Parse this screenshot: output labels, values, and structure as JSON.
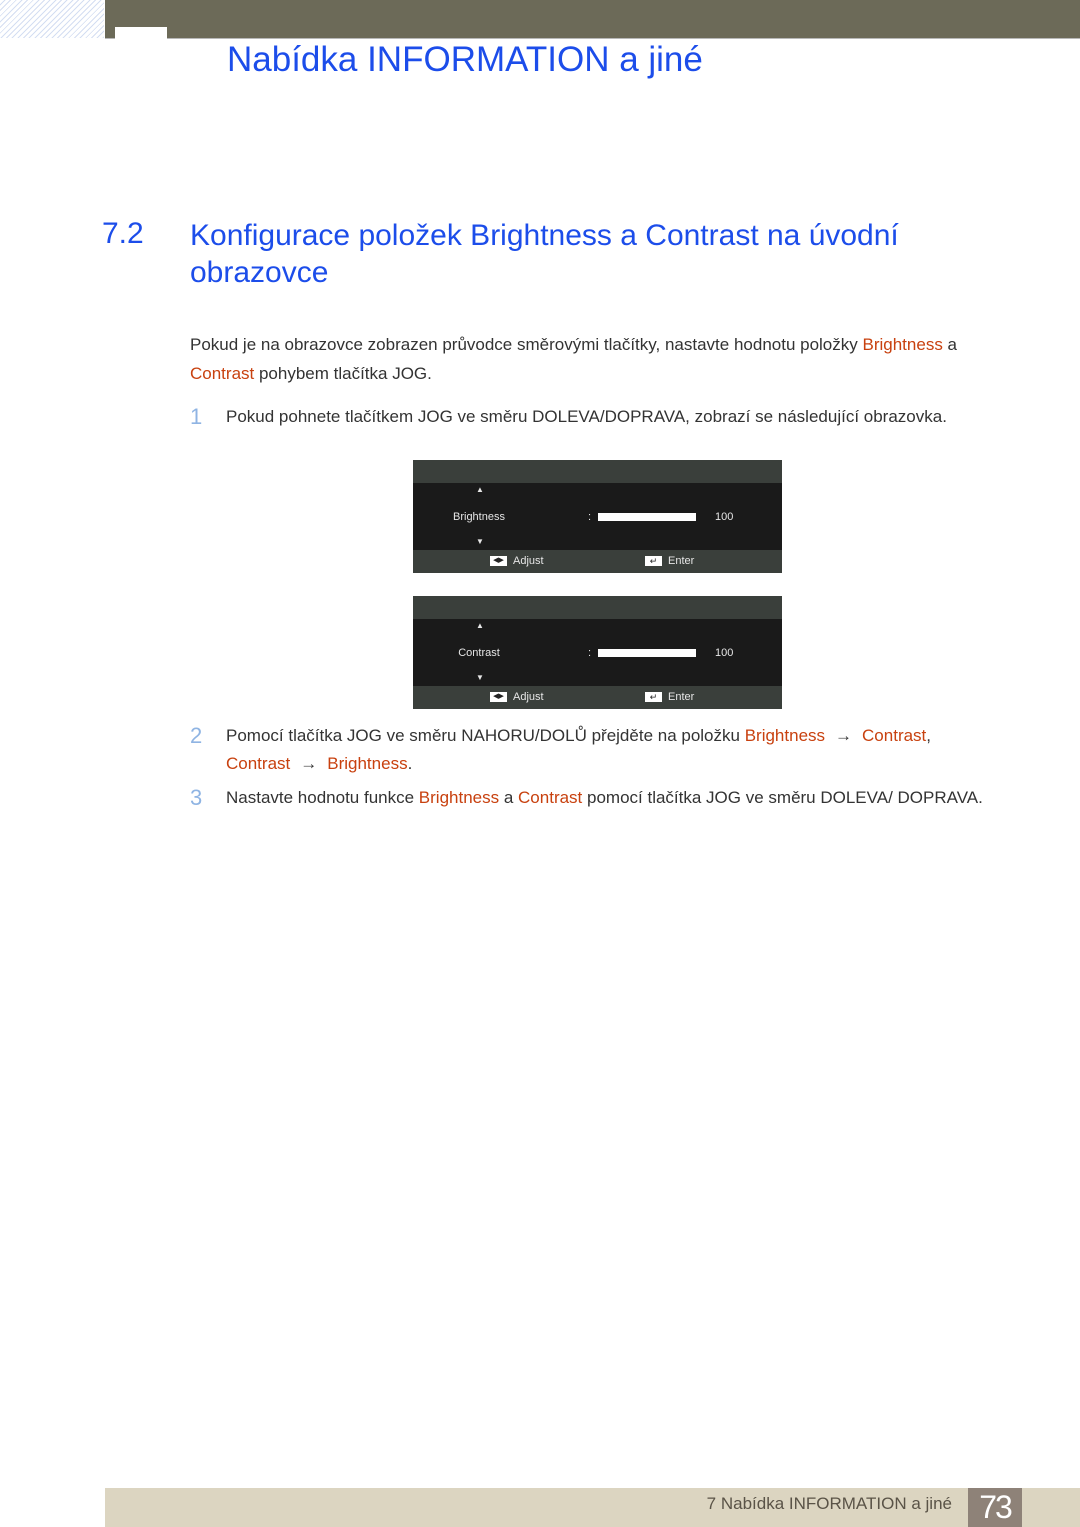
{
  "header": {
    "chapter_title": "Nabídka INFORMATION a jiné"
  },
  "section": {
    "number": "7.2",
    "title": "Konfigurace položek Brightness a Contrast na úvodní obrazovce"
  },
  "intro": {
    "part1": "Pokud je na obrazovce zobrazen průvodce směrovými tlačítky, nastavte hodnotu položky ",
    "hl1": "Brightness",
    "part2": " a ",
    "hl2": "Contrast",
    "part3": " pohybem tlačítka JOG."
  },
  "steps": [
    {
      "num": "1",
      "text": "Pokud pohnete tlačítkem JOG ve směru DOLEVA/DOPRAVA, zobrazí se následující obrazovka."
    },
    {
      "num": "2",
      "part1": "Pomocí tlačítka JOG ve směru NAHORU/DOLŮ přejděte na položku ",
      "hl1": "Brightness",
      "arrow": "→",
      "hl2": "Contrast",
      "sep": ", ",
      "hl3": "Contrast",
      "hl4": "Brightness",
      "end": "."
    },
    {
      "num": "3",
      "part1": "Nastavte hodnotu funkce ",
      "hl1": "Brightness",
      "part2": " a ",
      "hl2": "Contrast",
      "part3": " pomocí tlačítka JOG ve směru DOLEVA/ DOPRAVA."
    }
  ],
  "osd_screens": [
    {
      "label": "Brightness",
      "colon": ":",
      "value": "100",
      "level_percent": 100,
      "up_icon": "▲",
      "down_icon": "▼",
      "adjust_icon": "◀▶",
      "adjust_label": "Adjust",
      "enter_icon": "↵",
      "enter_label": "Enter"
    },
    {
      "label": "Contrast",
      "colon": ":",
      "value": "100",
      "level_percent": 100,
      "up_icon": "▲",
      "down_icon": "▼",
      "adjust_icon": "◀▶",
      "adjust_label": "Adjust",
      "enter_icon": "↵",
      "enter_label": "Enter"
    }
  ],
  "footer": {
    "text": "7 Nabídka INFORMATION a jiné",
    "page_number": "73"
  },
  "colors": {
    "heading_blue": "#1c4dea",
    "highlight_orange": "#c8410f",
    "step_number_blue": "#8fb4e3"
  }
}
